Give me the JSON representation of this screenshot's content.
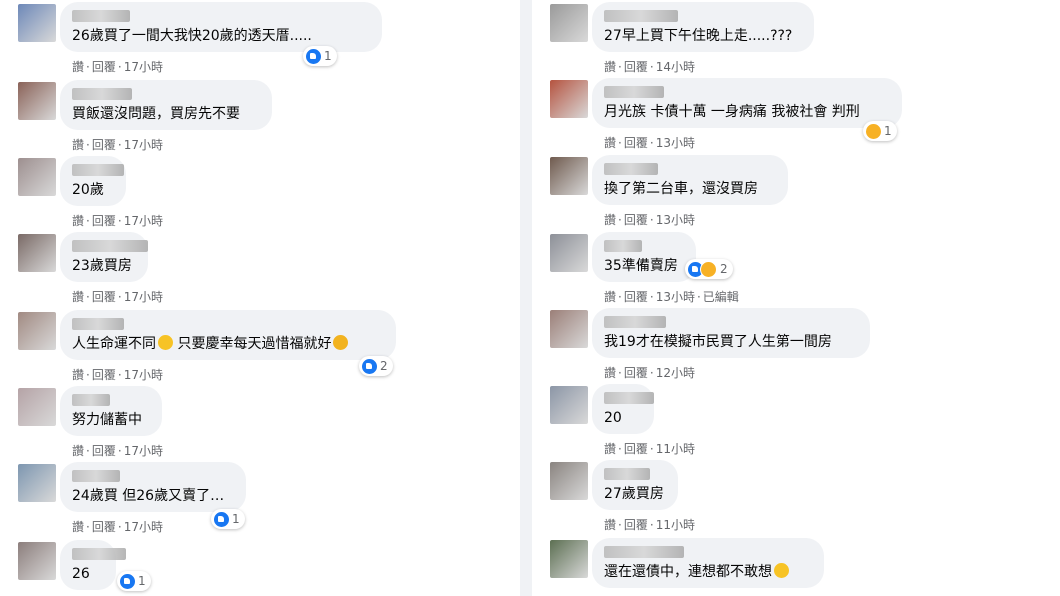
{
  "actions": {
    "like": "讚",
    "reply": "回覆",
    "sep": "·"
  },
  "left": [
    {
      "text": "26歲買了一間大我快20歲的透天厝.....",
      "time": "17小時",
      "reactions": "1",
      "reaction_icons": [
        "like-icon"
      ],
      "avatar_color": "#6d88b8"
    },
    {
      "text": "買飯還沒問題，買房先不要",
      "time": "17小時",
      "avatar_color": "#8a6258"
    },
    {
      "text": "20歲",
      "time": "17小時",
      "avatar_color": "#9d8f8f"
    },
    {
      "text": "23歲買房",
      "time": "17小時",
      "avatar_color": "#7a6a66"
    },
    {
      "text": "人生命運不同",
      "emoji1": "thinking-emoji",
      "text2": " 只要慶幸每天過惜福就好",
      "emoji2": "sunglasses-emoji",
      "time": "17小時",
      "reactions": "2",
      "reaction_icons": [
        "like-icon"
      ],
      "avatar_color": "#a18a82"
    },
    {
      "text": "努力儲蓄中",
      "time": "17小時",
      "avatar_color": "#b5a3a6"
    },
    {
      "text": "24歲買 但26歲又賣了…",
      "time": "17小時",
      "reactions": "1",
      "reaction_icons": [
        "like-icon"
      ],
      "avatar_color": "#7d96b0"
    },
    {
      "text": "26",
      "time": "",
      "reactions": "1",
      "reaction_icons": [
        "like-icon"
      ],
      "avatar_color": "#8c7e7c"
    }
  ],
  "right": [
    {
      "text": "27早上買下午住晚上走.....???",
      "time": "14小時",
      "avatar_color": "#9a9a9a"
    },
    {
      "text": "月光族 卡債十萬 一身病痛 我被社會 判刑",
      "time": "13小時",
      "reactions": "1",
      "reaction_icons": [
        "sad-icon"
      ],
      "avatar_color": "#b5533f"
    },
    {
      "text": "換了第二台車，還沒買房",
      "time": "13小時",
      "avatar_color": "#6f5a4e"
    },
    {
      "text": "35準備賣房",
      "time": "13小時",
      "edited": "已編輯",
      "reactions": "2",
      "reaction_icons": [
        "like-icon",
        "haha-icon"
      ],
      "avatar_color": "#8d9098"
    },
    {
      "text": "我19才在模擬市民買了人生第一間房",
      "time": "12小時",
      "avatar_color": "#9b7f78"
    },
    {
      "text": "20",
      "time": "11小時",
      "avatar_color": "#8c96a6"
    },
    {
      "text": "27歲買房",
      "time": "11小時",
      "avatar_color": "#8a8480"
    },
    {
      "text": "還在還債中，連想都不敢想",
      "emoji1": "crying-emoji",
      "time": "",
      "avatar_color": "#5c6f52"
    }
  ]
}
